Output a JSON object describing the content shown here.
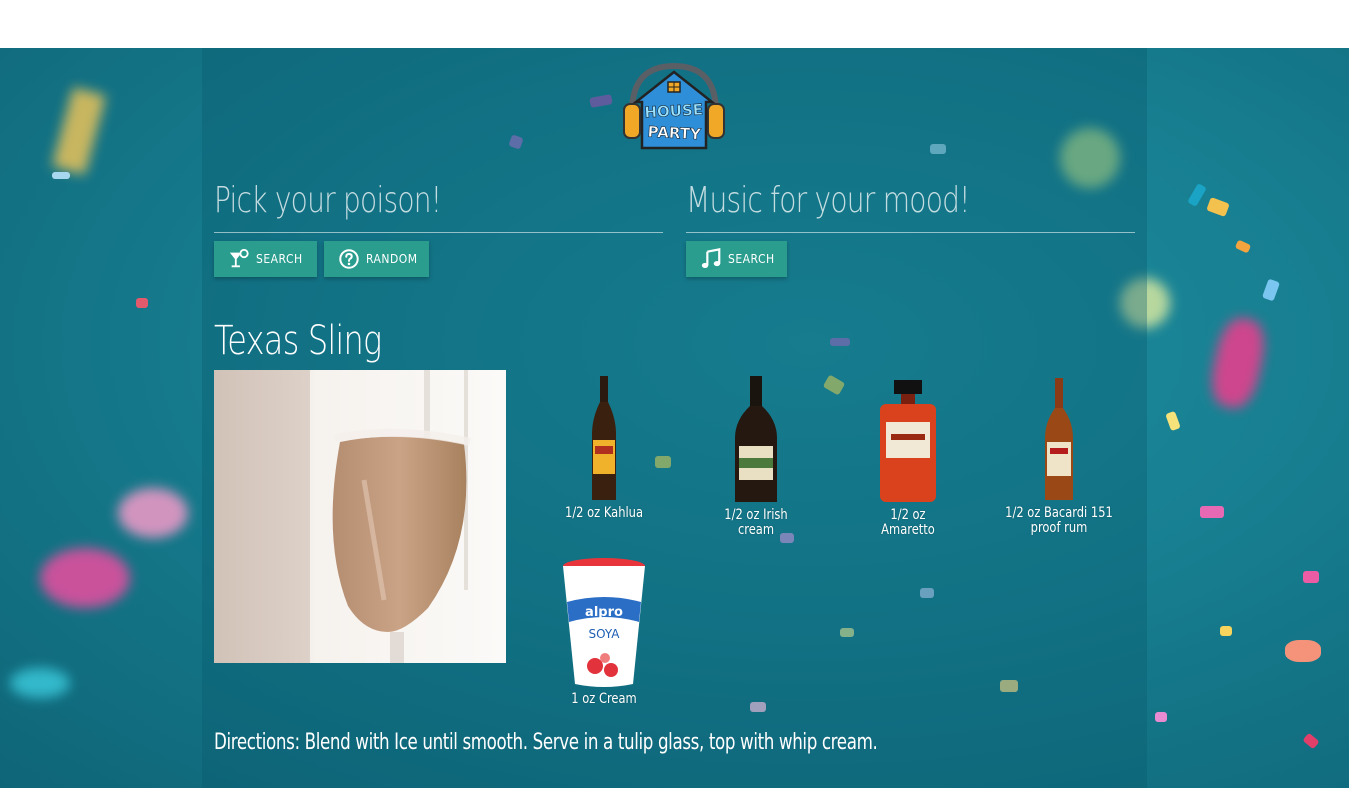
{
  "colors": {
    "accent_button": "#2a9d8f",
    "background": "#177f91",
    "text": "#ffffff"
  },
  "logo": {
    "text": "HOUSE PARTY",
    "icon": "house-headphones-logo"
  },
  "drinks_section": {
    "title": "Pick your poison!",
    "search_label": "search",
    "search_icon": "cocktail-icon",
    "random_label": "random",
    "random_icon": "question-circle-icon"
  },
  "music_section": {
    "title": "Music for your mood!",
    "search_label": "search",
    "search_icon": "music-note-icon"
  },
  "drink": {
    "name": "Texas Sling",
    "ingredients": [
      {
        "caption": "1/2 oz Kahlua",
        "icon": "kahlua-bottle"
      },
      {
        "caption": "1/2 oz Irish cream",
        "icon": "baileys-bottle"
      },
      {
        "caption": "1/2 oz Amaretto",
        "icon": "disaronno-bottle"
      },
      {
        "caption": "1/2 oz Bacardi 151 proof rum",
        "icon": "bacardi-bottle"
      },
      {
        "caption": "1 oz Cream",
        "icon": "cream-cup"
      }
    ],
    "directions": "Directions: Blend with Ice until smooth. Serve in a tulip glass, top with whip cream."
  }
}
